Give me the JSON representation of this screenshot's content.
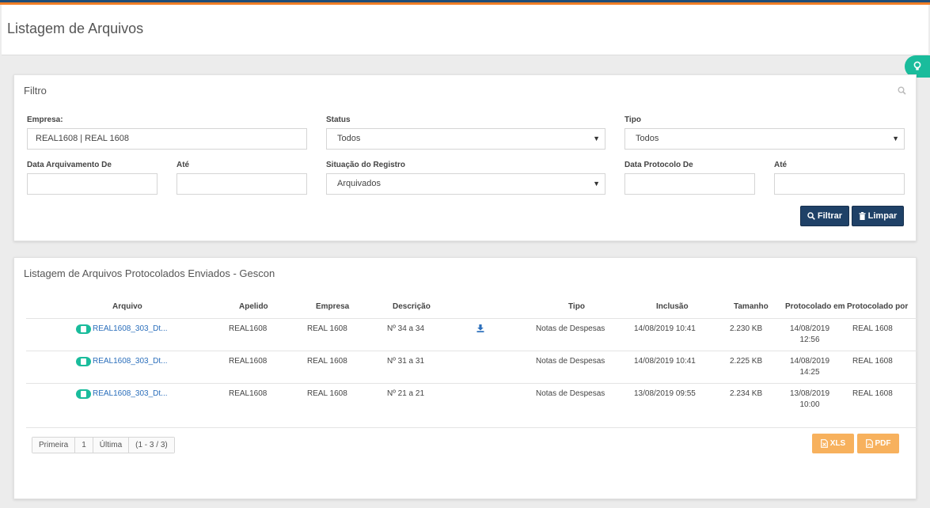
{
  "page": {
    "title": "Listagem de Arquivos"
  },
  "filter": {
    "title": "Filtro",
    "empresa": {
      "label": "Empresa:",
      "value": "REAL1608 | REAL 1608"
    },
    "status": {
      "label": "Status",
      "value": "Todos"
    },
    "tipo": {
      "label": "Tipo",
      "value": "Todos"
    },
    "data_arquivamento_de": {
      "label": "Data Arquivamento De",
      "value": ""
    },
    "ate1": {
      "label": "Até",
      "value": ""
    },
    "situacao": {
      "label": "Situação do Registro",
      "value": "Arquivados"
    },
    "data_protocolo_de": {
      "label": "Data Protocolo De",
      "value": ""
    },
    "ate2": {
      "label": "Até",
      "value": ""
    },
    "filtrar_label": "Filtrar",
    "limpar_label": "Limpar"
  },
  "list": {
    "title": "Listagem de Arquivos Protocolados Enviados - Gescon",
    "columns": {
      "arquivo": "Arquivo",
      "apelido": "Apelido",
      "empresa": "Empresa",
      "descricao": "Descrição",
      "tipo": "Tipo",
      "inclusao": "Inclusão",
      "tamanho": "Tamanho",
      "protocolado_em": "Protocolado em",
      "protocolado_por": "Protocolado por"
    },
    "rows": [
      {
        "arquivo": "REAL1608_303_Dt...",
        "apelido": "REAL1608",
        "empresa": "REAL 1608",
        "descricao": "Nº 34 a 34",
        "tipo": "Notas de Despesas",
        "inclusao": "14/08/2019 10:41",
        "tamanho": "2.230 KB",
        "prot_date": "14/08/2019",
        "prot_time": "12:56",
        "prot_por": "REAL 1608"
      },
      {
        "arquivo": "REAL1608_303_Dt...",
        "apelido": "REAL1608",
        "empresa": "REAL 1608",
        "descricao": "Nº 31 a 31",
        "tipo": "Notas de Despesas",
        "inclusao": "14/08/2019 10:41",
        "tamanho": "2.225 KB",
        "prot_date": "14/08/2019",
        "prot_time": "14:25",
        "prot_por": "REAL 1608"
      },
      {
        "arquivo": "REAL1608_303_Dt...",
        "apelido": "REAL1608",
        "empresa": "REAL 1608",
        "descricao": "Nº 21 a 21",
        "tipo": "Notas de Despesas",
        "inclusao": "13/08/2019 09:55",
        "tamanho": "2.234 KB",
        "prot_date": "13/08/2019",
        "prot_time": "10:00",
        "prot_por": "REAL 1608"
      }
    ],
    "pager": {
      "first": "Primeira",
      "page": "1",
      "last": "Última",
      "range": "(1 - 3 / 3)"
    },
    "export": {
      "xls": "XLS",
      "pdf": "PDF"
    }
  },
  "colors": {
    "primary": "#1f4167",
    "accent_green": "#1abc9c",
    "orange": "#f7b15d",
    "link": "#2a6ebb"
  }
}
